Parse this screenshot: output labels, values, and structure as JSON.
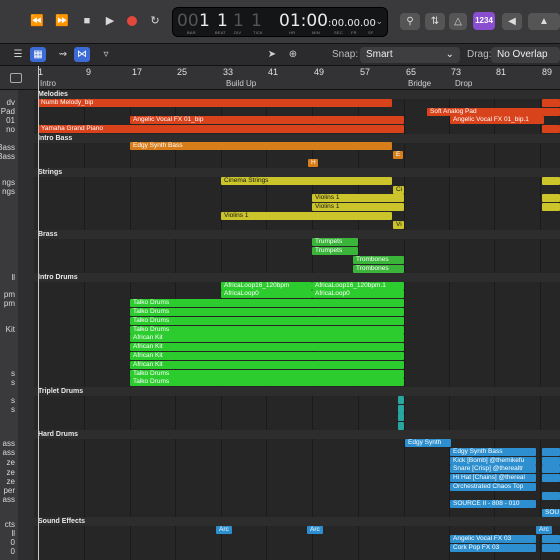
{
  "colors": {
    "orange_red": "#d8431c",
    "orange": "#d77e1b",
    "olive": "#cbc42a",
    "green": "#3ab53a",
    "bright_green": "#2ccc2e",
    "teal": "#27a7a0",
    "blue": "#2d8fcf",
    "record_red": "#e4473b"
  },
  "lcd": {
    "bar": "1",
    "beat": "1",
    "div": "1",
    "tick": "1",
    "time": "01:00",
    "time_small": ":00.00.00",
    "bar_label": "BAR",
    "beat_label": "BEAT",
    "div_label": "DIV",
    "tick_label": "TICK",
    "hr_label": "HR",
    "min_label": "MIN",
    "sec_label": "SEC",
    "fr_label": "FR",
    "sf_label": "SF"
  },
  "tag": "1234",
  "toolbar": {
    "snap_label": "Snap:",
    "snap_value": "Smart",
    "drag_label": "Drag:",
    "drag_value": "No Overlap"
  },
  "ruler": {
    "bars": [
      "1",
      "9",
      "17",
      "25",
      "33",
      "41",
      "49",
      "57",
      "65",
      "73",
      "81",
      "89"
    ],
    "markers": [
      "Intro",
      "Build Up",
      "Bridge",
      "Drop"
    ]
  },
  "track_names": [
    "dv",
    "Pad",
    "01",
    "no",
    "Bass",
    "Bass",
    "ngs",
    "ngs",
    "Kit",
    "ll",
    "pm",
    "pm",
    "Kit",
    "s",
    "s",
    "s",
    "s",
    "ass",
    "ass",
    "ze",
    "ze",
    "ze",
    "per",
    "ass",
    "cts",
    "ll",
    "0",
    "0"
  ],
  "folders": {
    "melodies": "Melodies",
    "intro_bass": "Intro Bass",
    "strings": "Strings",
    "brass": "Brass",
    "intro_drums": "Intro Drums",
    "triplet_drums": "Triplet Drums",
    "hard_drums": "Hard Drums",
    "sound_effects": "Sound Effects"
  },
  "regions": {
    "numb_melody": "Numb Melody_bip",
    "angelic_fx": "Angelic Vocal FX 01_bip",
    "yamaha": "Yamaha Grand Piano",
    "soft_pad": "Soft Analog Pad",
    "angelic_fx_1": "Angelic Vocal FX 01_bip.1",
    "edgy_synth_bass": "Edgy Synth Bass",
    "h": "H",
    "e": "E",
    "cinema_strings": "Cinema Strings",
    "ci": "Ci",
    "violins_1a": "Violins 1",
    "violins_1b": "Violins 1",
    "violins_1c": "Violins 1",
    "vi": "Vi",
    "trumpets_a": "Trumpets",
    "trumpets_b": "Trumpets",
    "trombones_a": "Trombones",
    "trombones_b": "Trombones",
    "africa_a": "AfricaLoop16_120bpm",
    "africa_b": "AfricaLoop16_120bpm.1",
    "africa_c": "AfricaLoop0",
    "africa_d": "AfricaLoop0",
    "talko": "Talko Drums",
    "african_kit": "African Kit",
    "edgy_synth": "Edgy Synth",
    "edgy_synth_bass_2": "Edgy Synth Bass",
    "kick": "Kick [Bomb] @themikefu",
    "snare": "Snare [Crisp] @therealtr",
    "hihat": "Hi Hat [Chains] @thereal",
    "orch": "Orchestrated Chaos Top",
    "source": "SOURCE II - 808 - 010",
    "sou": "SOU",
    "arc": "Arc",
    "angelic_fx03": "Angelic Vocal FX 03",
    "cork_pop": "Cork Pop FX 03"
  }
}
